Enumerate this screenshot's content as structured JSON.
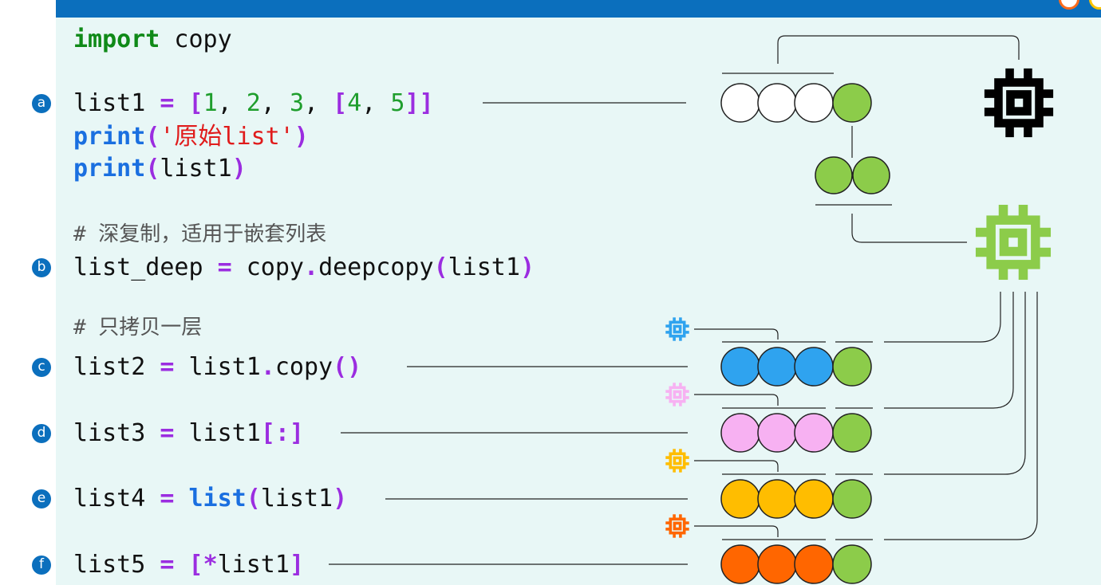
{
  "code": {
    "line_import": {
      "keyword": "import",
      "rest": " copy"
    },
    "line_a": {
      "badge": "a",
      "var": "list1",
      "assign": " = ",
      "l1": "[",
      "n1": "1",
      "c1": ", ",
      "n2": "2",
      "c2": ", ",
      "n3": "3",
      "c3": ", ",
      "l2": "[",
      "n4": "4",
      "c4": ", ",
      "n5": "5",
      "r2": "]",
      "r1": "]"
    },
    "line_print1": {
      "fn": "print",
      "open": "(",
      "str": "'原始list'",
      "close": ")"
    },
    "line_print2": {
      "fn": "print",
      "open": "(",
      "arg": "list1",
      "close": ")"
    },
    "comment_deep": "# 深复制，适用于嵌套列表",
    "line_b": {
      "badge": "b",
      "var": "list_deep",
      "assign": " = ",
      "obj": "copy",
      "dot": ".",
      "method": "deepcopy",
      "open": "(",
      "arg": "list1",
      "close": ")"
    },
    "comment_shallow": "# 只拷贝一层",
    "line_c": {
      "badge": "c",
      "var": "list2",
      "assign": " = ",
      "obj": "list1",
      "dot": ".",
      "method": "copy",
      "parens": "()"
    },
    "line_d": {
      "badge": "d",
      "var": "list3",
      "assign": " = ",
      "obj": "list1",
      "slice": "[:]"
    },
    "line_e": {
      "badge": "e",
      "var": "list4",
      "assign": " = ",
      "fn": "list",
      "open": "(",
      "arg": "list1",
      "close": ")"
    },
    "line_f": {
      "badge": "f",
      "var": "list5",
      "assign": " = ",
      "open": "[",
      "star": "*",
      "arg": "list1",
      "close": "]"
    }
  },
  "diagram": {
    "rows": [
      {
        "id": "original",
        "fill": "#ffffff",
        "chip_color": "#000000"
      },
      {
        "id": "list2",
        "fill": "#2fa3ef",
        "chip_color": "#2fa3ef"
      },
      {
        "id": "list3",
        "fill": "#f7b1f2",
        "chip_color": "#f7b1f2"
      },
      {
        "id": "list4",
        "fill": "#ffbd00",
        "chip_color": "#ffbd00"
      },
      {
        "id": "list5",
        "fill": "#ff6600",
        "chip_color": "#ff6600"
      }
    ],
    "nested_fill": "#8ccc4a",
    "deep_chip_color": "#8ccc4a"
  },
  "colors": {
    "header": "#0b6fbd",
    "panel": "#e8f7f6",
    "badge": "#0b6fbd"
  }
}
